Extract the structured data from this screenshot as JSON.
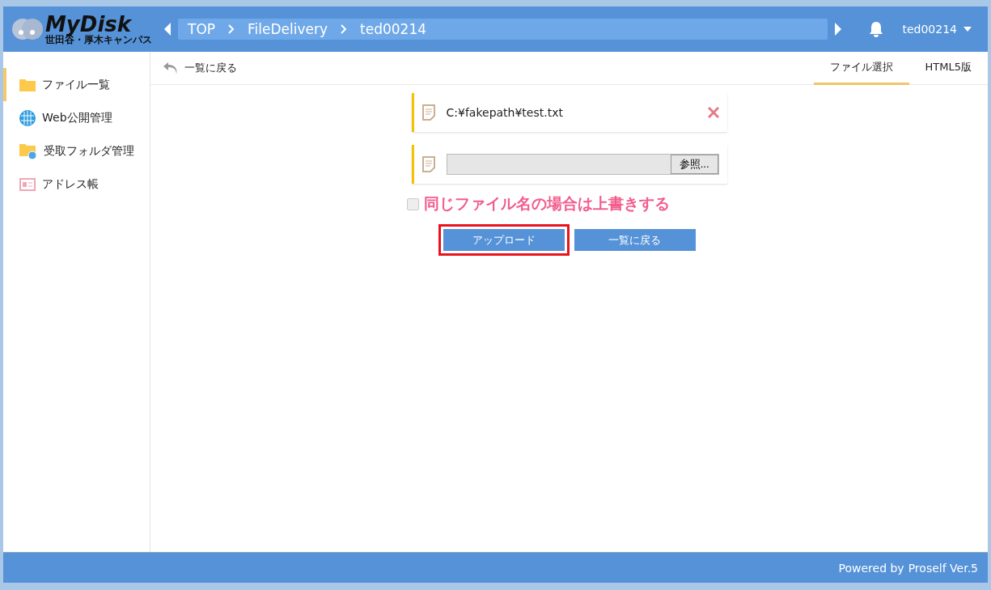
{
  "header": {
    "logo": {
      "title": "MyDisk",
      "subtitle": "世田谷・厚木キャンパス"
    },
    "breadcrumbs": [
      "TOP",
      "FileDelivery",
      "ted00214"
    ],
    "user": "ted00214"
  },
  "sidebar": {
    "items": [
      {
        "label": "ファイル一覧",
        "kind": "folder",
        "selected": true
      },
      {
        "label": "Web公開管理",
        "kind": "globe",
        "selected": false
      },
      {
        "label": "受取フォルダ管理",
        "kind": "shared-folder",
        "selected": false
      },
      {
        "label": "アドレス帳",
        "kind": "contacts",
        "selected": false
      }
    ]
  },
  "toolbar": {
    "back": "一覧に戻る",
    "tabs": [
      {
        "label": "ファイル選択",
        "selected": true
      },
      {
        "label": "HTML5版",
        "selected": false
      }
    ]
  },
  "files": [
    {
      "kind": "chosen",
      "path": "C:¥fakepath¥test.txt"
    },
    {
      "kind": "picker",
      "button": "参照..."
    }
  ],
  "overwrite": {
    "label": "同じファイル名の場合は上書きする",
    "checked": false
  },
  "buttons": [
    {
      "label": "アップロード",
      "highlighted": true
    },
    {
      "label": "一覧に戻る",
      "highlighted": false
    }
  ],
  "footer": {
    "text": "Powered by",
    "link": "Proself Ver.5"
  }
}
